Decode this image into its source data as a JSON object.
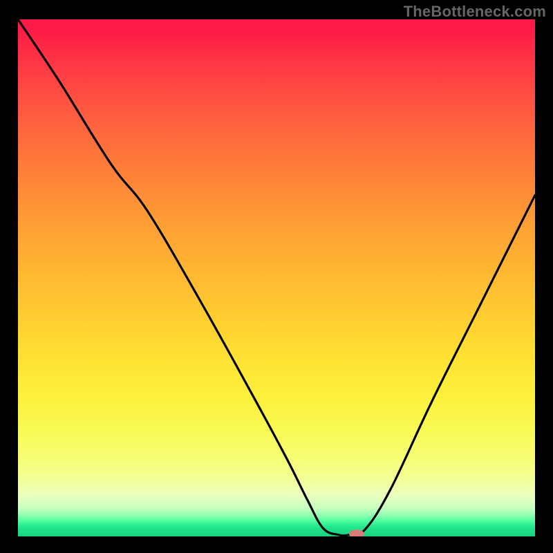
{
  "watermark": "TheBottleneck.com",
  "chart_data": {
    "type": "line",
    "title": "",
    "xlabel": "",
    "ylabel": "",
    "xlim": [
      0,
      100
    ],
    "ylim": [
      0,
      100
    ],
    "grid": false,
    "legend": false,
    "series": [
      {
        "name": "curve",
        "x": [
          0,
          8,
          18,
          25,
          35,
          45,
          52,
          56,
          59,
          62,
          64,
          67,
          72,
          80,
          90,
          100
        ],
        "y": [
          100,
          88,
          72,
          63,
          46,
          28,
          15,
          7,
          1.6,
          0.3,
          0.3,
          1.2,
          9,
          26,
          46,
          66
        ]
      }
    ],
    "marker": {
      "x": 65.5,
      "y": 0.5,
      "color": "#d97a78",
      "rx": 11,
      "ry": 6
    },
    "gradient_stops": [
      {
        "pos": 0,
        "color": "#fe1a47"
      },
      {
        "pos": 0.5,
        "color": "#ffce31"
      },
      {
        "pos": 0.8,
        "color": "#f8fb57"
      },
      {
        "pos": 0.97,
        "color": "#4effa1"
      },
      {
        "pos": 1.0,
        "color": "#19d180"
      }
    ]
  }
}
